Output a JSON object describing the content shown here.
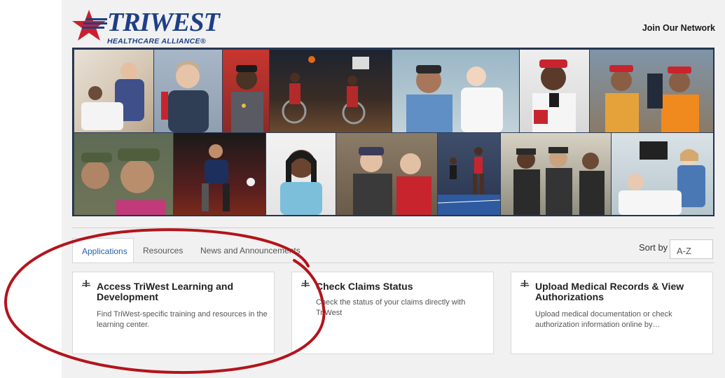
{
  "brand": {
    "name": "TRIWEST",
    "subtitle": "HEALTHCARE ALLIANCE®",
    "colors": {
      "primary": "#1e3f87",
      "star": "#cc1f2d",
      "link_active": "#2a5fa8"
    }
  },
  "header": {
    "join_link": "Join Our Network"
  },
  "tabs": [
    {
      "label": "Applications",
      "active": true
    },
    {
      "label": "Resources",
      "active": false
    },
    {
      "label": "News and Announcements",
      "active": false
    }
  ],
  "sort": {
    "label": "Sort by",
    "value": "A-Z"
  },
  "cards": [
    {
      "icon": "application-icon",
      "title": "Access TriWest Learning and Development",
      "description": "Find TriWest-specific training and resources in the learning center."
    },
    {
      "icon": "application-icon",
      "title": "Check Claims Status",
      "description": "Check the status of your claims directly with TriWest"
    },
    {
      "icon": "application-icon",
      "title": "Upload Medical Records & View Authorizations",
      "description": "Upload medical documentation or check authorization information online by…"
    }
  ],
  "annotation": {
    "shape": "ellipse",
    "color": "#b3141c"
  }
}
